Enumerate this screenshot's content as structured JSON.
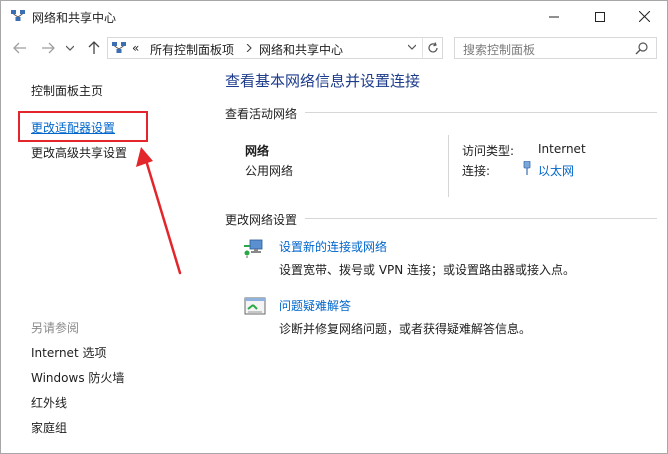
{
  "window": {
    "title": "网络和共享中心"
  },
  "address": {
    "overflow": "«",
    "segments": [
      "所有控制面板项",
      "网络和共享中心"
    ],
    "search_placeholder": "搜索控制面板"
  },
  "left": {
    "home": "控制面板主页",
    "links": [
      "更改适配器设置",
      "更改高级共享设置"
    ],
    "see_also_title": "另请参阅",
    "see_also": [
      "Internet 选项",
      "Windows 防火墙",
      "红外线",
      "家庭组"
    ]
  },
  "main": {
    "title": "查看基本网络信息并设置连接",
    "active_header": "查看活动网络",
    "network": {
      "name": "网络",
      "type": "公用网络",
      "access_label": "访问类型:",
      "access_value": "Internet",
      "conn_label": "连接:",
      "conn_value": "以太网"
    },
    "change_header": "更改网络设置",
    "tasks": [
      {
        "title": "设置新的连接或网络",
        "desc": "设置宽带、拨号或 VPN 连接；或设置路由器或接入点。",
        "icon": "network-setup-icon"
      },
      {
        "title": "问题疑难解答",
        "desc": "诊断并修复网络问题，或者获得疑难解答信息。",
        "icon": "troubleshoot-icon"
      }
    ]
  },
  "colors": {
    "link": "#0066cc",
    "title": "#1e3c8c",
    "annotation": "#e2262b"
  }
}
